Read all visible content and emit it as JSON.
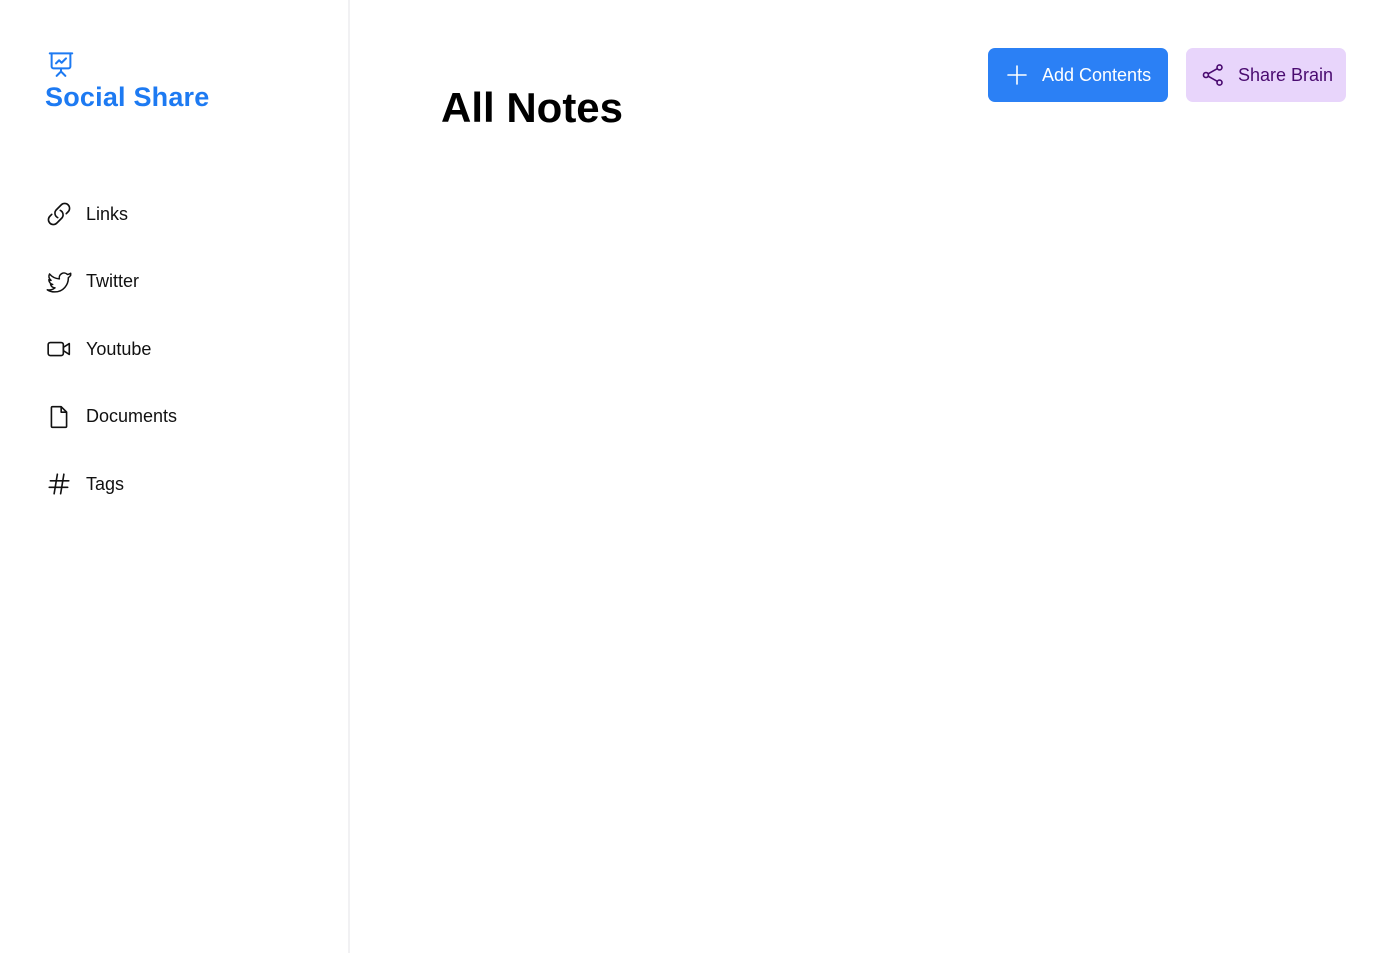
{
  "brand": {
    "name": "Social Share",
    "icon": "presentation-chart-icon",
    "color": "#1d7af2"
  },
  "sidebar": {
    "items": [
      {
        "label": "Links",
        "icon": "link-icon"
      },
      {
        "label": "Twitter",
        "icon": "twitter-icon"
      },
      {
        "label": "Youtube",
        "icon": "video-camera-icon"
      },
      {
        "label": "Documents",
        "icon": "document-icon"
      },
      {
        "label": "Tags",
        "icon": "hashtag-icon"
      }
    ]
  },
  "main": {
    "title": "All Notes",
    "add_button": {
      "label": "Add Contents",
      "icon": "plus-icon",
      "color": "#2b80f5"
    },
    "share_button": {
      "label": "Share Brain",
      "icon": "share-icon",
      "color": "#e8d5fb",
      "text_color": "#4a0b70"
    }
  }
}
